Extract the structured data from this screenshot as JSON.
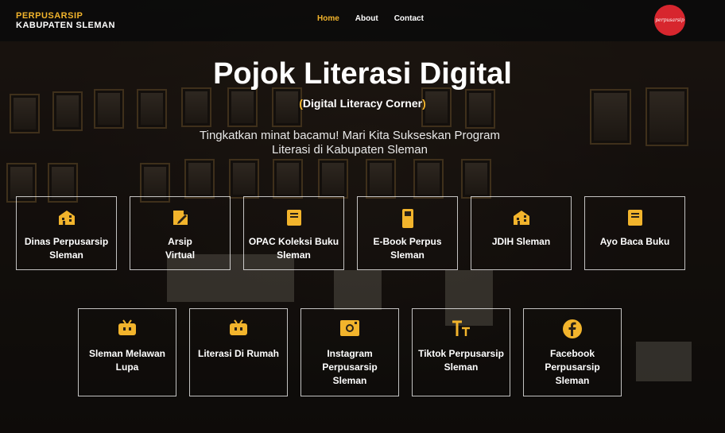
{
  "header": {
    "brand_line1": "PERPUSARSIP",
    "brand_line2": "KABUPATEN SLEMAN",
    "nav": [
      {
        "label": "Home",
        "active": true
      },
      {
        "label": "About",
        "active": false
      },
      {
        "label": "Contact",
        "active": false
      }
    ],
    "logo_text": "perpusarsip"
  },
  "hero": {
    "title": "Pojok Literasi Digital",
    "subtitle_open": "(",
    "subtitle_text": "Digital Literacy Corner",
    "subtitle_close": ")",
    "description": "Tingkatkan minat bacamu! Mari Kita Sukseskan Program Literasi di Kabupaten Sleman"
  },
  "cards_row1": [
    {
      "label": "Dinas Perpusarsip Sleman",
      "icon": "building-icon"
    },
    {
      "label": "Arsip Virtual",
      "icon": "document-edit-icon"
    },
    {
      "label": "OPAC Koleksi Buku Sleman",
      "icon": "book-icon"
    },
    {
      "label": "E-Book Perpus Sleman",
      "icon": "ebook-reader-icon"
    },
    {
      "label": "JDIH Sleman",
      "icon": "building-icon"
    },
    {
      "label": "Ayo Baca Buku",
      "icon": "book-icon"
    }
  ],
  "cards_row2": [
    {
      "label": "Sleman Melawan Lupa",
      "icon": "video-channel-icon"
    },
    {
      "label": "Literasi Di Rumah",
      "icon": "video-channel-icon"
    },
    {
      "label": "Instagram Perpusarsip Sleman",
      "icon": "instagram-icon"
    },
    {
      "label": "Tiktok Perpusarsip Sleman",
      "icon": "text-size-icon"
    },
    {
      "label": "Facebook Perpusarsip Sleman",
      "icon": "facebook-icon"
    }
  ],
  "colors": {
    "accent": "#f2b42c",
    "logo_red": "#d7262e",
    "header_bg": "#0a0a0a"
  }
}
